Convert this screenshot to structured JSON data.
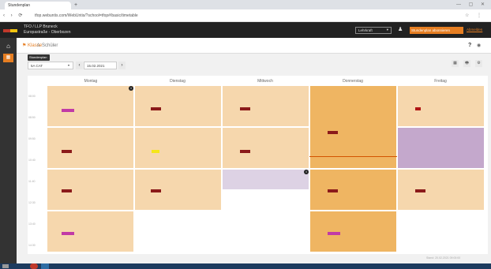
{
  "browser": {
    "tab_title": "Stundenplan",
    "new_tab": "+",
    "window_controls": "— ▢ ✕",
    "nav": "‹ › ⟳",
    "url": "tfop.webuntis.com/WebUntis/?school=tfop#/basic/timetable",
    "omni_right": "☆ ⋮"
  },
  "header": {
    "school_line1": "TFO / LLP Bruneck",
    "school_line2": "Europastraße - Oberbozen",
    "user_dropdown": "Lehrkraft",
    "orange_button": "Stundenplan abonnieren",
    "link": "Abmelden"
  },
  "sidebar": {
    "home_icon": "home-icon",
    "calendar_icon": "calendar-icon"
  },
  "subnav": {
    "tab_classes": "Klasse",
    "tab_students": "Schüler",
    "help": "?",
    "eye": "👁"
  },
  "toolbar": {
    "tooltip": "Stundenplan",
    "class_select": "5A CAT",
    "prev": "‹",
    "week": "15.02.2021",
    "next": "›",
    "icons": [
      "▦",
      "🖶",
      "⚙"
    ]
  },
  "days": [
    "Montag",
    "Dienstag",
    "Mittwoch",
    "Donnerstag",
    "Freitag"
  ],
  "times": [
    "08:00",
    "08:50",
    "09:50",
    "10:40",
    "11:40",
    "12:30",
    "13:40",
    "14:30"
  ],
  "footer_stamp": "Stand: 20.02.2021 09:00:00",
  "colors": {
    "light": "#f6d7ad",
    "dark": "#efb562",
    "purple": "#c4a8cc",
    "lavender": "#ddd2e4",
    "orange": "#e67e22"
  }
}
